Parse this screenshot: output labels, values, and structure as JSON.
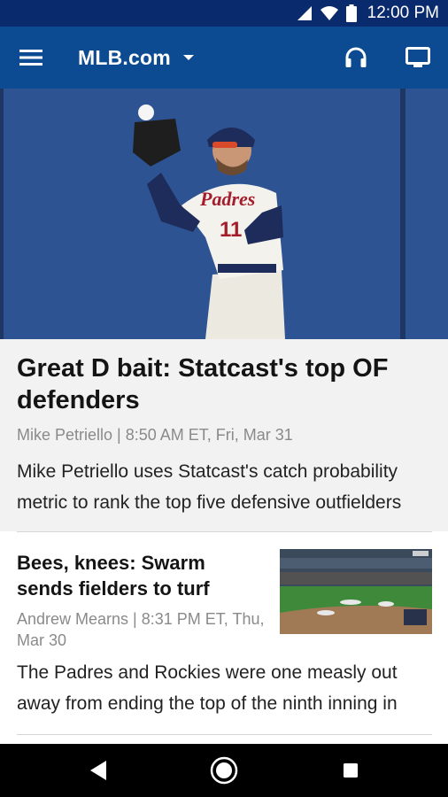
{
  "status_bar": {
    "time": "12:00 PM",
    "icons": [
      "cellular-signal-icon",
      "wifi-icon",
      "battery-icon"
    ]
  },
  "app_bar": {
    "title": "MLB.com",
    "icons": [
      "hamburger-menu-icon",
      "dropdown-arrow-icon",
      "headphones-icon",
      "tv-icon"
    ]
  },
  "hero_story": {
    "title": "Great D bait: Statcast's top OF defenders",
    "meta": "Mike Petriello | 8:50 AM ET, Fri, Mar 31",
    "summary_line1": "Mike Petriello uses Statcast's catch probability",
    "summary_line2": "metric to rank the top five defensive outfielders",
    "image": {
      "jersey_text": "Padres",
      "jersey_number": "11"
    }
  },
  "story_2": {
    "title": "Bees, knees: Swarm sends fielders to turf",
    "meta": "Andrew Mearns | 8:31 PM ET, Thu, Mar 30",
    "summary_line1": "The Padres and Rockies were one measly out",
    "summary_line2": "away from ending the top of the ninth inning in"
  },
  "nav_bar": {
    "icons": [
      "back-icon",
      "home-icon",
      "recents-icon"
    ]
  },
  "colors": {
    "status_bar": "#0a2a6e",
    "app_bar": "#0c4a91",
    "hero_background": "#f2f2f2",
    "meta_text": "#8a8a8a"
  }
}
